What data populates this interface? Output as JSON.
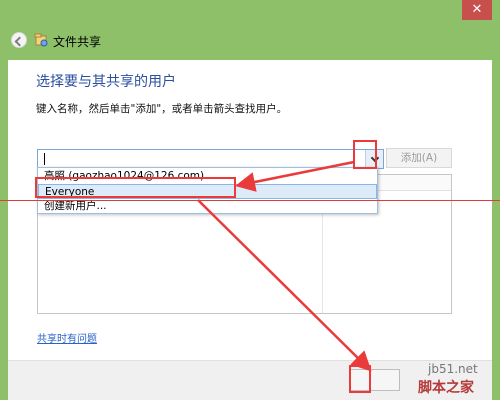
{
  "window": {
    "title": "文件共享",
    "close_label": "✕"
  },
  "dialog": {
    "heading": "选择要与其共享的用户",
    "instruction": "键入名称，然后单击\"添加\"，或者单击箭头查找用户。",
    "input_value": "",
    "add_button": "添加(A)",
    "dropdown_items": [
      "高照 (gaozhao1024@126.com)",
      "Everyone",
      "创建新用户..."
    ],
    "help_link": "共享时有问题"
  },
  "watermark": {
    "site": "jb51.net",
    "brand": "脚本之家"
  },
  "colors": {
    "window_frame": "#8ec06a",
    "heading": "#2a4fa0",
    "link": "#2a62c9",
    "highlight": "#ea3a3a",
    "selection": "#ddebf8"
  },
  "icons": {
    "back": "back-arrow-icon",
    "share": "file-share-icon",
    "dropdown": "chevron-down-icon"
  }
}
